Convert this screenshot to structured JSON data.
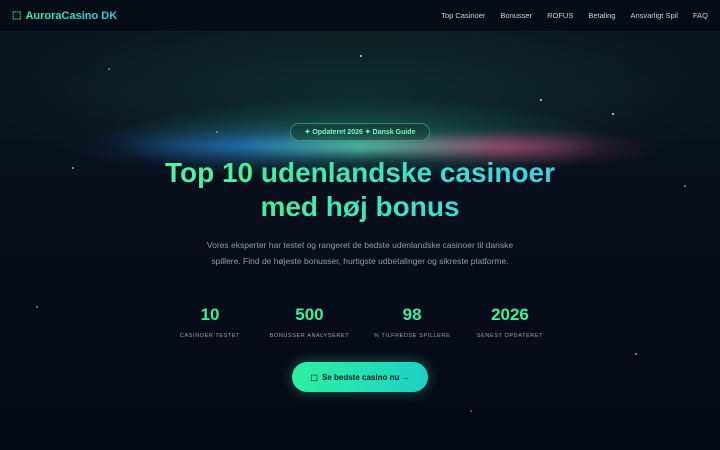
{
  "nav": {
    "brand_icon": "⬚",
    "brand": "AuroraCasino DK",
    "links": [
      "Top Casinoer",
      "Bonusser",
      "ROFUS",
      "Betaling",
      "Ansvarligt Spil",
      "FAQ"
    ]
  },
  "hero": {
    "badge": "✦ Opdateret 2026 ✦ Dansk Guide",
    "title_line1": "Top 10 udenlandske casinoer",
    "title_line2": "med høj bonus",
    "subtitle": "Vores eksperter har testet og rangeret de bedste udenlandske casinoer til danske spillere. Find de højeste bonusser, hurtigste udbetalinger og sikreste platforme.",
    "stats": [
      {
        "value": "10",
        "label": "Casinoer testet"
      },
      {
        "value": "500",
        "label": "Bonusser analyseret"
      },
      {
        "value": "98",
        "label": "% tilfredse spillere"
      },
      {
        "value": "2026",
        "label": "Senest opdateret"
      }
    ],
    "cta_icon": "⬚",
    "cta": "Se bedste casino nu →"
  },
  "colors": {
    "accent": "#2ef0a0",
    "accent2": "#3fd7e0",
    "background": "#070b17"
  }
}
